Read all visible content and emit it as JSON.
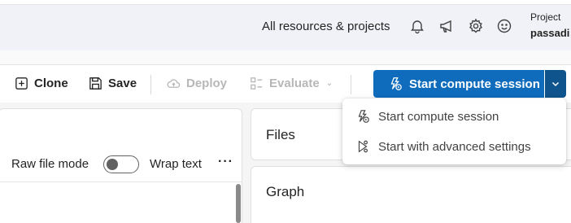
{
  "header": {
    "resources_label": "All resources & projects",
    "icons": [
      "bell-icon",
      "megaphone-icon",
      "gear-icon",
      "smiley-icon"
    ],
    "project_label": "Project",
    "project_name": "passadi"
  },
  "toolbar": {
    "clone_label": "Clone",
    "save_label": "Save",
    "deploy_label": "Deploy",
    "evaluate_label": "Evaluate",
    "start_label": "Start compute session"
  },
  "dropdown": {
    "items": [
      {
        "label": "Start compute session",
        "icon": "compute-start-icon"
      },
      {
        "label": "Start with advanced settings",
        "icon": "advanced-start-icon"
      }
    ]
  },
  "editor": {
    "raw_file_mode_label": "Raw file mode",
    "raw_file_mode_on": false,
    "wrap_text_label": "Wrap text",
    "more_label": "···"
  },
  "panels": {
    "files_title": "Files",
    "graph_title": "Graph"
  },
  "colors": {
    "primary": "#0f6cbd",
    "primary_dark": "#0f548c",
    "header_bg": "#f0f2f7"
  }
}
